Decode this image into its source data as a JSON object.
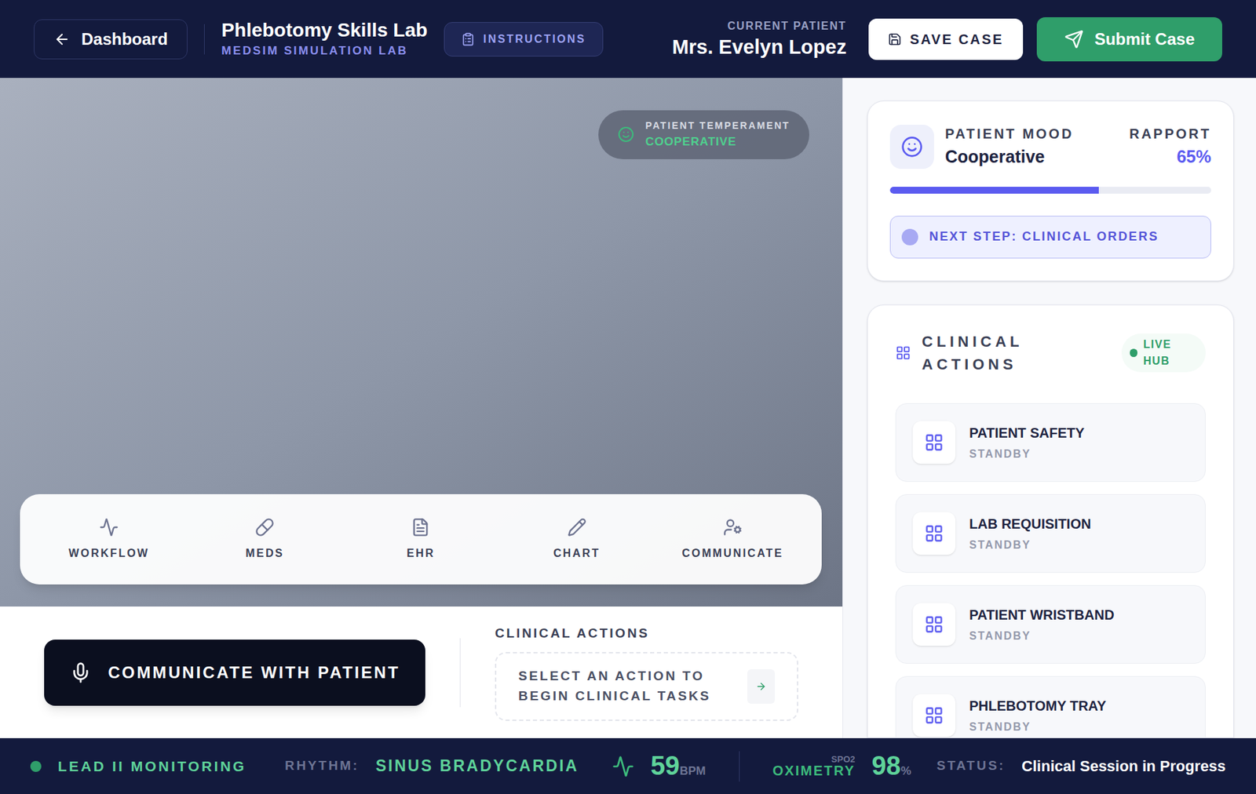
{
  "header": {
    "back": "Dashboard",
    "title": "Phlebotomy Skills Lab",
    "subtitle": "MEDSIM SIMULATION LAB",
    "instructions": "INSTRUCTIONS",
    "patient_label": "CURRENT PATIENT",
    "patient_name": "Mrs. Evelyn Lopez",
    "save": "SAVE CASE",
    "submit": "Submit Case"
  },
  "temperament": {
    "label": "PATIENT TEMPERAMENT",
    "value": "COOPERATIVE"
  },
  "toolbar": [
    {
      "label": "WORKFLOW",
      "kind": "workflow"
    },
    {
      "label": "MEDS",
      "kind": "meds"
    },
    {
      "label": "EHR",
      "kind": "ehr"
    },
    {
      "label": "CHART",
      "kind": "chart"
    },
    {
      "label": "COMMUNICATE",
      "kind": "communicate"
    }
  ],
  "communicate": "COMMUNICATE WITH PATIENT",
  "clinical_prompt": {
    "title": "CLINICAL ACTIONS",
    "text": "SELECT AN ACTION TO BEGIN CLINICAL TASKS"
  },
  "mood": {
    "label": "PATIENT MOOD",
    "value": "Cooperative",
    "rapport_label": "RAPPORT",
    "rapport": "65%",
    "level": 0.65,
    "next_step": "NEXT STEP: CLINICAL ORDERS"
  },
  "actions_panel": {
    "title": "CLINICAL ACTIONS",
    "live": "LIVE HUB",
    "items": [
      {
        "name": "PATIENT SAFETY",
        "status": "STANDBY"
      },
      {
        "name": "LAB REQUISITION",
        "status": "STANDBY"
      },
      {
        "name": "PATIENT WRISTBAND",
        "status": "STANDBY"
      },
      {
        "name": "PHLEBOTOMY TRAY",
        "status": "STANDBY"
      }
    ]
  },
  "status_bar": {
    "monitor": "LEAD II MONITORING",
    "rhythm_label": "RHYTHM:",
    "rhythm": "SINUS BRADYCARDIA",
    "bpm": "59",
    "bpm_unit": "BPM",
    "spo2_label": "SPO2",
    "oximetry": "OXIMETRY",
    "spo2": "98",
    "spo2_unit": "%",
    "status_label": "STATUS:",
    "status": "Clinical Session in Progress"
  }
}
